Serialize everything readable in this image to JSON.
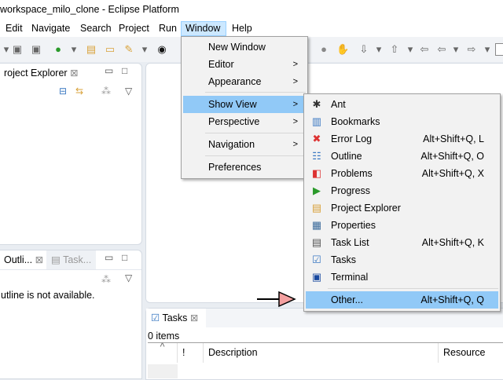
{
  "window": {
    "title": "workspace_milo_clone - Eclipse Platform"
  },
  "menubar": [
    {
      "label": "Edit"
    },
    {
      "label": "Navigate"
    },
    {
      "label": "Search"
    },
    {
      "label": "Project"
    },
    {
      "label": "Run"
    },
    {
      "label": "Window"
    },
    {
      "label": "Help"
    }
  ],
  "window_menu": {
    "items": [
      {
        "label": "New Window"
      },
      {
        "label": "Editor"
      },
      {
        "label": "Appearance"
      },
      {
        "label": "Show View"
      },
      {
        "label": "Perspective"
      },
      {
        "label": "Navigation"
      },
      {
        "label": "Preferences"
      }
    ]
  },
  "show_view_menu": {
    "items": [
      {
        "label": "Ant",
        "shortcut": "",
        "icon": "ant-icon"
      },
      {
        "label": "Bookmarks",
        "shortcut": "",
        "icon": "bookmarks-icon"
      },
      {
        "label": "Error Log",
        "shortcut": "Alt+Shift+Q, L",
        "icon": "error-log-icon"
      },
      {
        "label": "Outline",
        "shortcut": "Alt+Shift+Q, O",
        "icon": "outline-icon"
      },
      {
        "label": "Problems",
        "shortcut": "Alt+Shift+Q, X",
        "icon": "problems-icon"
      },
      {
        "label": "Progress",
        "shortcut": "",
        "icon": "progress-icon"
      },
      {
        "label": "Project Explorer",
        "shortcut": "",
        "icon": "project-explorer-icon"
      },
      {
        "label": "Properties",
        "shortcut": "",
        "icon": "properties-icon"
      },
      {
        "label": "Task List",
        "shortcut": "Alt+Shift+Q, K",
        "icon": "task-list-icon"
      },
      {
        "label": "Tasks",
        "shortcut": "",
        "icon": "tasks-icon"
      },
      {
        "label": "Terminal",
        "shortcut": "",
        "icon": "terminal-icon"
      },
      {
        "label": "Other...",
        "shortcut": "Alt+Shift+Q, Q",
        "icon": ""
      }
    ]
  },
  "project_explorer": {
    "tab": "roject Explorer"
  },
  "outline": {
    "tab": "Outli...",
    "tab2": "Task...",
    "message": "utline is not available."
  },
  "tasks": {
    "tab": "Tasks",
    "count": "0 items",
    "columns": [
      "!",
      "Description",
      "Resource"
    ]
  },
  "colors": {
    "highlight": "#91c9f7",
    "arrow": "#f4a0a0"
  }
}
